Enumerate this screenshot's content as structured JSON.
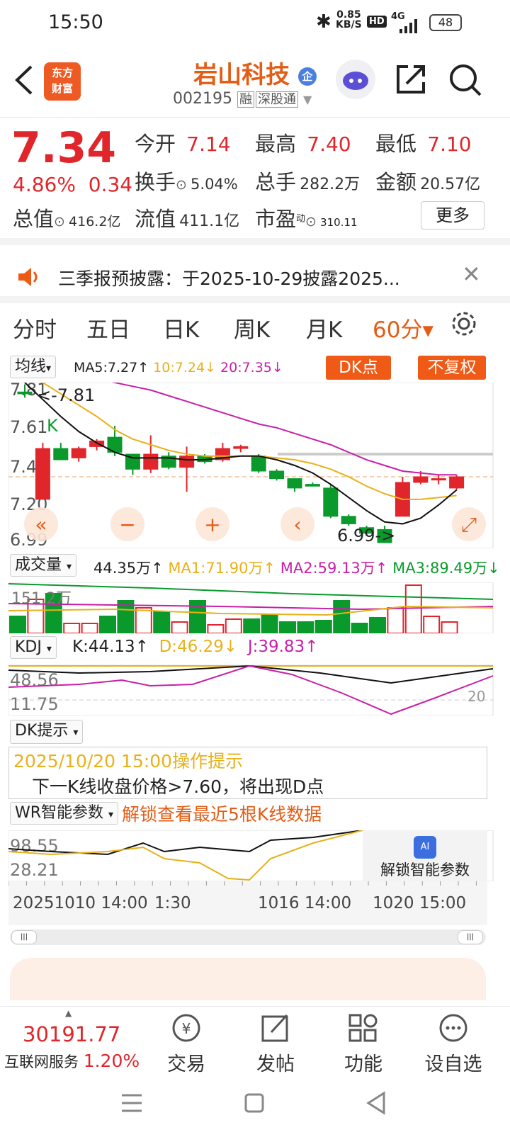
{
  "status": {
    "time": "15:50",
    "speed": "0.85",
    "speed_unit": "KB/S",
    "hd": "HD",
    "net": "4G",
    "battery": "48"
  },
  "header": {
    "logo_line1": "东方",
    "logo_line2": "财富",
    "stock_name": "岩山科技",
    "badge": "企",
    "code": "002195",
    "tag_margin": "融",
    "tag_connect": "深股通"
  },
  "quote": {
    "price": "7.34",
    "change_pct": "4.86%",
    "change": "0.34",
    "open_label": "今开",
    "open": "7.14",
    "high_label": "最高",
    "high": "7.40",
    "low_label": "最低",
    "low": "7.10",
    "turnover_label": "换手",
    "turnover": "5.04%",
    "volume_label": "总手",
    "volume": "282.2万",
    "amount_label": "金额",
    "amount": "20.57亿",
    "mcap_label": "总值",
    "mcap": "416.2亿",
    "float_label": "流值",
    "float": "411.1亿",
    "pe_label": "市盈",
    "pe_sup": "动",
    "pe": "310.11",
    "more": "更多"
  },
  "notice": {
    "text": "三季报预披露：于2025-10-29披露2025..."
  },
  "tabs": [
    "分时",
    "五日",
    "日K",
    "周K",
    "月K",
    "60分▾"
  ],
  "tabs_active": 5,
  "kline": {
    "ma_select": "均线",
    "ma5": "MA5:7.27",
    "ma10": "10:7.24",
    "ma20": "20:7.35",
    "dk_btn": "DK点",
    "fq_btn": "不复权",
    "y_labels": [
      "7.81",
      "7.61",
      "7.40",
      "7.20",
      "6.99"
    ],
    "high_mark": "<-7.81",
    "low_mark": "6.99->",
    "k_mark": "K",
    "candles": [
      [
        7.79,
        7.78,
        7.83,
        7.76
      ],
      [
        7.22,
        7.49,
        7.52,
        7.22
      ],
      [
        7.49,
        7.43,
        7.52,
        7.43
      ],
      [
        7.44,
        7.49,
        7.5,
        7.42
      ],
      [
        7.5,
        7.53,
        7.54,
        7.48
      ],
      [
        7.55,
        7.47,
        7.61,
        7.45
      ],
      [
        7.46,
        7.38,
        7.46,
        7.35
      ],
      [
        7.38,
        7.46,
        7.56,
        7.36
      ],
      [
        7.45,
        7.39,
        7.47,
        7.38
      ],
      [
        7.39,
        7.45,
        7.5,
        7.26
      ],
      [
        7.45,
        7.42,
        7.46,
        7.41
      ],
      [
        7.43,
        7.49,
        7.52,
        7.42
      ],
      [
        7.49,
        7.5,
        7.51,
        7.47
      ],
      [
        7.45,
        7.37,
        7.46,
        7.36
      ],
      [
        7.37,
        7.33,
        7.38,
        7.32
      ],
      [
        7.33,
        7.28,
        7.33,
        7.26
      ],
      [
        7.3,
        7.29,
        7.31,
        7.29
      ],
      [
        7.28,
        7.13,
        7.3,
        7.12
      ],
      [
        7.13,
        7.09,
        7.14,
        7.08
      ],
      [
        7.07,
        7.04,
        7.08,
        7.03
      ],
      [
        7.06,
        6.99,
        7.08,
        6.99
      ],
      [
        7.13,
        7.31,
        7.34,
        7.13
      ],
      [
        7.31,
        7.34,
        7.37,
        7.3
      ],
      [
        7.33,
        7.33,
        7.35,
        7.3
      ],
      [
        7.28,
        7.34,
        7.35,
        7.27
      ]
    ],
    "controls": [
      "«",
      "−",
      "+",
      "‹",
      "⤢"
    ]
  },
  "volume": {
    "select": "成交量",
    "cur": "44.35万",
    "ma1": "MA1:71.90万",
    "ma2": "MA2:59.13万",
    "ma3": "MA3:89.49万",
    "y_label": "151.2万"
  },
  "kdj": {
    "select": "KDJ",
    "k": "K:44.13",
    "d": "D:46.29",
    "j": "J:39.83",
    "y1": "48.56",
    "y2": "11.75",
    "y3": "20"
  },
  "dk": {
    "select": "DK提示",
    "time": "2025/10/20 15:00操作提示",
    "text": "下一K线收盘价格>7.60，将出现D点"
  },
  "wr": {
    "select": "WR智能参数",
    "unlock": "解锁查看最近5根K线数据",
    "y1": "98.55",
    "y2": "28.21",
    "unlock_btn": "解锁智能参数"
  },
  "x_axis": [
    "20251010 14:00",
    "1:30",
    "1016 14:00",
    "1020 15:00"
  ],
  "bottom": {
    "index": "30191.77",
    "sector": "互联网服务",
    "sector_pct": "1.20%",
    "trade": "交易",
    "post": "发帖",
    "func": "功能",
    "watch": "设自选"
  },
  "colors": {
    "up": "#e0262b",
    "down": "#0a9a2c",
    "accent": "#ef5a16",
    "ma10": "#e8b11a",
    "ma20": "#c81fa8"
  }
}
